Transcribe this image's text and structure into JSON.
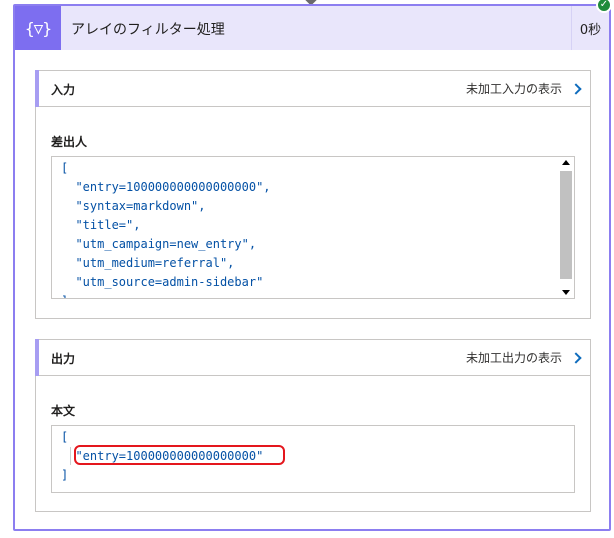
{
  "action": {
    "icon": "filter-array-icon",
    "icon_glyph": "{▽}",
    "title": "アレイのフィルター処理",
    "duration": "0秒",
    "status": "succeeded",
    "accent_color": "#7d6ef0",
    "status_color": "#1f8b3a"
  },
  "inputs": {
    "section_label": "入力",
    "raw_link": "未加工入力の表示",
    "field_label": "差出人",
    "lines": [
      "[",
      "  \"entry=100000000000000000\",",
      "  \"syntax=markdown\",",
      "  \"title=\",",
      "  \"utm_campaign=new_entry\",",
      "  \"utm_medium=referral\",",
      "  \"utm_source=admin-sidebar\"",
      "]"
    ]
  },
  "outputs": {
    "section_label": "出力",
    "raw_link": "未加工出力の表示",
    "field_label": "本文",
    "lines": [
      "[",
      "  \"entry=100000000000000000\"",
      "]"
    ],
    "highlight_color": "#e4161d"
  }
}
